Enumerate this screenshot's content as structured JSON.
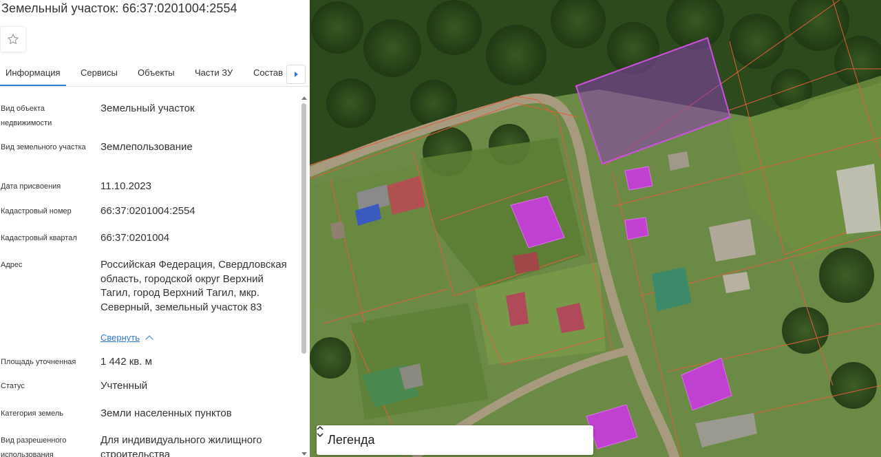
{
  "panel": {
    "title": "Земельный участок: 66:37:0201004:2554",
    "tabs": [
      "Информация",
      "Сервисы",
      "Объекты",
      "Части ЗУ",
      "Состав"
    ],
    "active_tab": "Информация",
    "fields": [
      {
        "label": "Вид объекта недвижимости",
        "value": "Земельный участок"
      },
      {
        "label": "Вид земельного участка",
        "value": "Землепользование"
      },
      {
        "label": "Дата присвоения",
        "value": "11.10.2023"
      },
      {
        "label": "Кадастровый номер",
        "value": "66:37:0201004:2554"
      },
      {
        "label": "Кадастровый квартал",
        "value": "66:37:0201004"
      },
      {
        "label": "Адрес",
        "value": "Российская Федерация, Свердловская область, городской округ Верхний Тагил, город Верхний Тагил, мкр. Северный, земельный участок 83"
      },
      {
        "label": "Площадь уточненная",
        "value": "1 442 кв. м"
      },
      {
        "label": "Статус",
        "value": "Учтенный"
      },
      {
        "label": "Категория земель",
        "value": "Земли населенных пунктов"
      },
      {
        "label": "Вид разрешенного использования",
        "value": "Для индивидуального жилищного строительства"
      }
    ],
    "collapse_link": "Свернуть"
  },
  "map": {
    "legend_label": "Легенда",
    "parcel_highlight_color": "#c040d0",
    "boundary_color": "#e0603c"
  },
  "icons": {
    "favorite": "star-outline-icon",
    "tabs_next": "triangle-right-icon",
    "collapse": "chevron-up-icon",
    "legend_toggle": "sort-updown-icon"
  }
}
